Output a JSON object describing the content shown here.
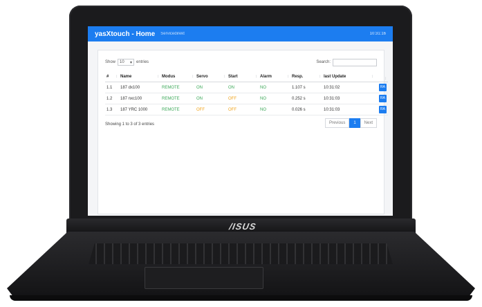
{
  "navbar": {
    "brand": "yasXtouch - Home",
    "sub": "Servicedirekt",
    "time": "10:31:16"
  },
  "controls": {
    "show_label": "Show",
    "page_length": "10",
    "entries_label": "entries",
    "search_label": "Search:"
  },
  "table": {
    "headers": [
      "#",
      "Name",
      "Modus",
      "Servo",
      "Start",
      "Alarm",
      "Resp.",
      "last Update",
      ""
    ],
    "rows": [
      {
        "id": "1.1",
        "name": "187 dx100",
        "modus": "REMOTE",
        "servo": "ON",
        "start": "ON",
        "alarm": "NO",
        "resp": "1.107 s",
        "update": "10:31:02",
        "action": "RA"
      },
      {
        "id": "1.2",
        "name": "187 nxc100",
        "modus": "REMOTE",
        "servo": "ON",
        "start": "OFF",
        "alarm": "NO",
        "resp": "0.252 s",
        "update": "10:31:03",
        "action": "RA"
      },
      {
        "id": "1.3",
        "name": "187 YRC 1000",
        "modus": "REMOTE",
        "servo": "OFF",
        "start": "OFF",
        "alarm": "NO",
        "resp": "0.026 s",
        "update": "10:31:03",
        "action": "RA"
      }
    ]
  },
  "footer": {
    "info": "Showing 1 to 3 of 3 entries",
    "prev": "Previous",
    "page": "1",
    "next": "Next"
  },
  "laptop": {
    "brand": "/ISUS"
  },
  "colors": {
    "accent": "#1c7df0",
    "on": "#3aa757",
    "off": "#f0a31a"
  }
}
